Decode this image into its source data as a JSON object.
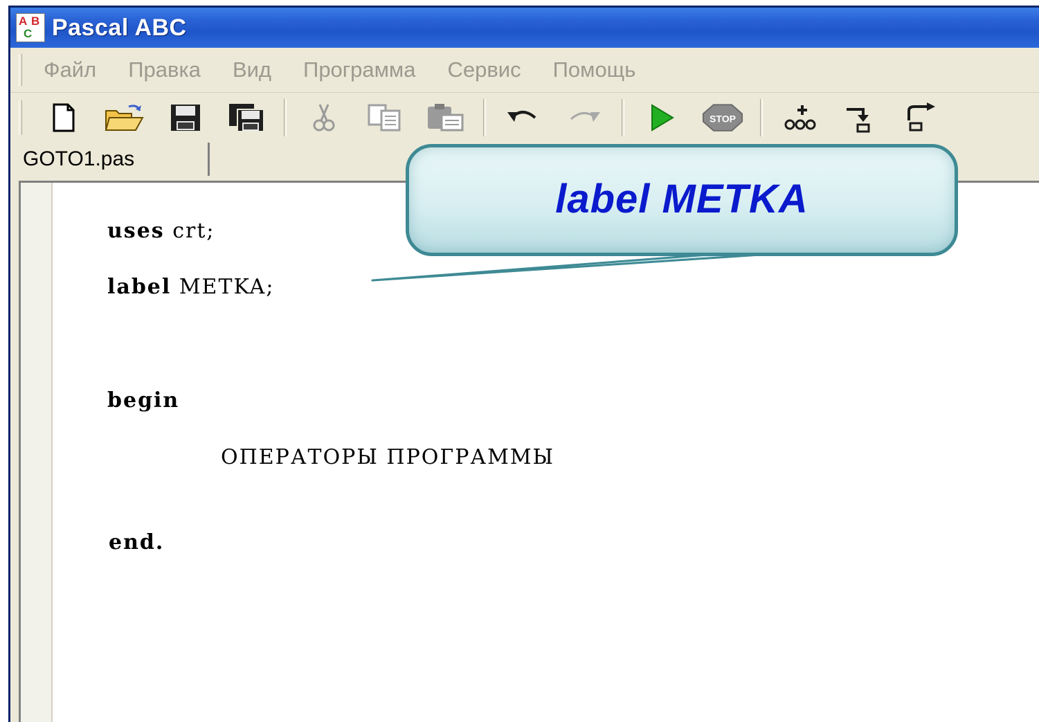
{
  "window": {
    "title": "Pascal ABC",
    "icon": "pascal-abc-app-icon",
    "icon_letters": [
      "A",
      "B",
      "C"
    ]
  },
  "menu": {
    "items": [
      "Файл",
      "Правка",
      "Вид",
      "Программа",
      "Сервис",
      "Помощь"
    ]
  },
  "toolbar": {
    "buttons": [
      "new-file-icon",
      "open-folder-icon",
      "save-icon",
      "save-all-icon",
      "cut-icon",
      "copy-icon",
      "paste-icon",
      "undo-icon",
      "redo-icon",
      "run-icon",
      "stop-icon",
      "add-watch-icon",
      "step-into-icon",
      "step-over-icon"
    ],
    "stop_label": "STOP"
  },
  "tabs": [
    {
      "label": "GOTO1.pas"
    }
  ],
  "editor": {
    "lines": [
      {
        "keyword": "uses",
        "rest": " crt;"
      },
      {
        "keyword": "label",
        "rest": " METKA;"
      },
      {
        "keyword": "begin",
        "rest": ""
      },
      {
        "keyword": "",
        "rest": "ОПЕРАТОРЫ ПРОГРАММЫ"
      },
      {
        "keyword": "end.",
        "rest": ""
      }
    ]
  },
  "callout": {
    "text": "label METKA",
    "border_color": "#3e8a94",
    "text_color": "#0a1acc"
  }
}
